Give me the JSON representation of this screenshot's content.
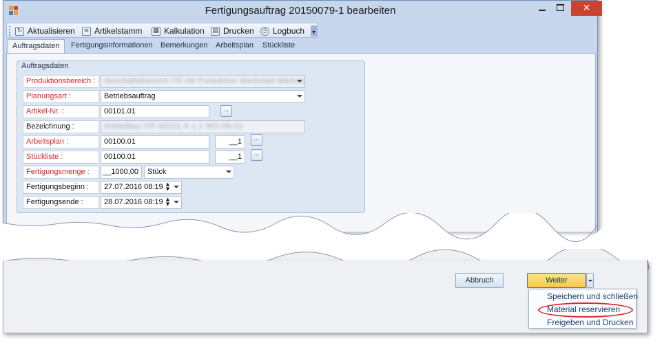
{
  "window": {
    "title": "Fertigungsauftrag 20150079-1 bearbeiten",
    "close_glyph": "✕"
  },
  "toolbar": {
    "items": [
      {
        "label": "Aktualisieren",
        "icon": "refresh-icon"
      },
      {
        "label": "Artikelstamm",
        "icon": "card-icon"
      },
      {
        "label": "Kalkulation",
        "icon": "calculator-icon"
      },
      {
        "label": "Drucken",
        "icon": "printer-icon"
      },
      {
        "label": "Logbuch",
        "icon": "logbook-icon"
      }
    ]
  },
  "tabs": [
    "Auftragsdaten",
    "Fertigungsinformationen",
    "Bemerkungen",
    "Arbeitsplan",
    "Stückliste"
  ],
  "active_tab": "Auftragsdaten",
  "group_title": "Auftragsdaten",
  "form": {
    "produktionsbereich": {
      "label": "Produktionsbereich :",
      "value": "Geschäftsbereich ITF-09 Produktion Werkstatt Marbach"
    },
    "planungsart": {
      "label": "Planungsart :",
      "value": "Betriebsauftrag"
    },
    "artikel_nr": {
      "label": "Artikel-Nr. :",
      "value": "00101.01",
      "button": "..."
    },
    "bezeichnung": {
      "label": "Bezeichnung :",
      "value": "Artikelbez ITF-00101 S 1.1 WO-09-21"
    },
    "arbeitsplan": {
      "label": "Arbeitsplan :",
      "value": "00100.01",
      "version": "__1",
      "button": "..."
    },
    "stueckliste": {
      "label": "Stückliste :",
      "value": "00100.01",
      "version": "__1",
      "button": "..."
    },
    "fertigungsmenge": {
      "label": "Fertigungsmenge :",
      "value": "__1000,00",
      "unit": "Stück"
    },
    "fertigungsbeginn": {
      "label": "Fertigungsbeginn :",
      "value": "27.07.2016 08:19"
    },
    "fertigungsende": {
      "label": "Fertigungsende :",
      "value": "28.07.2016 08:19"
    }
  },
  "footer": {
    "cancel_label": "Abbruch",
    "next_label": "Weiter",
    "menu": [
      "Speichern und schließen",
      "Material reservieren",
      "Freigeben und Drucken"
    ],
    "highlighted_menu_item": "Material reservieren"
  },
  "colors": {
    "required_label": "#d8262a",
    "close_button": "#c84431",
    "weiter_button": "#f7c94a",
    "highlight_ring": "#d8262a"
  }
}
